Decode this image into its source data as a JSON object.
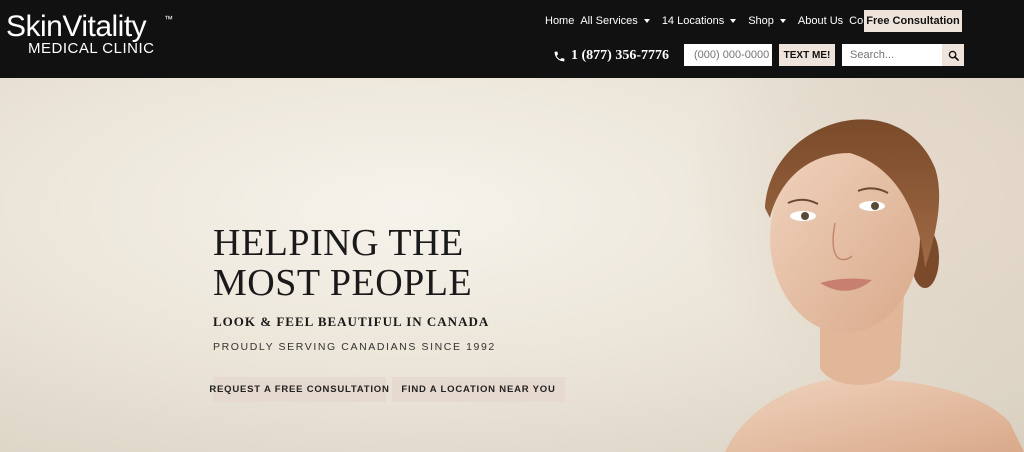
{
  "logo": {
    "main": "SkinVitality",
    "sub": "MEDICAL CLINIC",
    "tm": "™"
  },
  "nav": {
    "items": [
      {
        "label": "Home",
        "dropdown": false
      },
      {
        "label": "All Services",
        "dropdown": true
      },
      {
        "label": "14 Locations",
        "dropdown": true
      },
      {
        "label": "Shop",
        "dropdown": true
      },
      {
        "label": "About Us",
        "dropdown": false
      },
      {
        "label": "Contact Us",
        "dropdown": false
      }
    ],
    "cta_label": "Free Consultation"
  },
  "contact": {
    "phone": "1 (877) 356-7776",
    "phone_placeholder": "(000) 000-0000",
    "text_me_label": "TEXT ME!",
    "search_placeholder": "Search..."
  },
  "hero": {
    "headline_line1": "HELPING THE",
    "headline_line2": "MOST PEOPLE",
    "subheadline": "LOOK & FEEL BEAUTIFUL IN CANADA",
    "tagline": "PROUDLY SERVING CANADIANS SINCE 1992",
    "button_consult": "REQUEST A FREE CONSULTATION",
    "button_location": "FIND A LOCATION NEAR YOU"
  },
  "colors": {
    "header_bg": "#111111",
    "accent": "#efe4dc",
    "button_bg": "#e6d9cf"
  },
  "icons": {
    "phone": "phone-icon",
    "search": "search-icon",
    "caret": "chevron-down-icon"
  }
}
